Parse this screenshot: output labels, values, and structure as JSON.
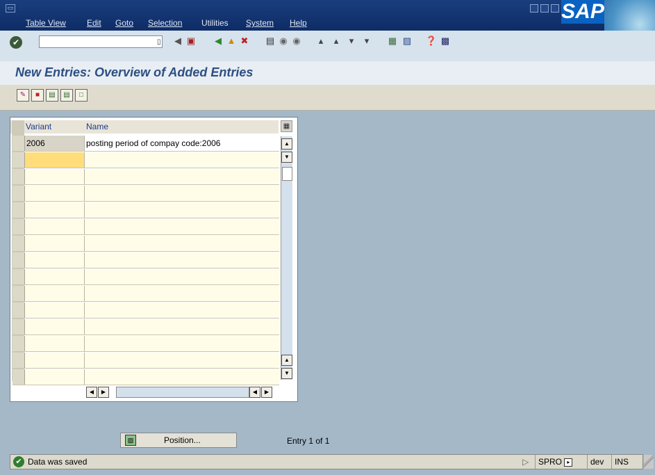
{
  "menu": {
    "items": [
      "Table View",
      "Edit",
      "Goto",
      "Selection",
      "Utilities",
      "System",
      "Help"
    ]
  },
  "brand": {
    "logo": "SAP"
  },
  "toolbar": {
    "command_value": "",
    "icons": [
      "enter-icon",
      "back-arrow-icon",
      "save-icon",
      "back-icon",
      "exit-icon",
      "cancel-icon",
      "print-icon",
      "find-icon",
      "find-next-icon",
      "first-page-icon",
      "prev-page-icon",
      "next-page-icon",
      "last-page-icon",
      "create-session-icon",
      "shortcut-icon",
      "help-icon",
      "layout-icon"
    ]
  },
  "page": {
    "title": "New Entries: Overview of Added Entries"
  },
  "app_toolbar": {
    "icons": [
      "change-display-icon",
      "delete-icon",
      "select-all-icon",
      "select-block-icon",
      "deselect-all-icon"
    ]
  },
  "table": {
    "columns": [
      "Variant",
      "Name"
    ],
    "rows": [
      {
        "variant": "2006",
        "name": "posting period of compay code:2006"
      }
    ]
  },
  "bottom": {
    "position_label": "Position...",
    "entry_text": "Entry 1 of 1"
  },
  "status": {
    "message": "Data was saved",
    "transaction": "SPRO",
    "system": "dev",
    "mode": "INS"
  },
  "colors": {
    "menubar": "#0e2c66",
    "title": "#2d4f82",
    "background": "#a4b8c8",
    "active_cell": "#ffdd7a"
  }
}
